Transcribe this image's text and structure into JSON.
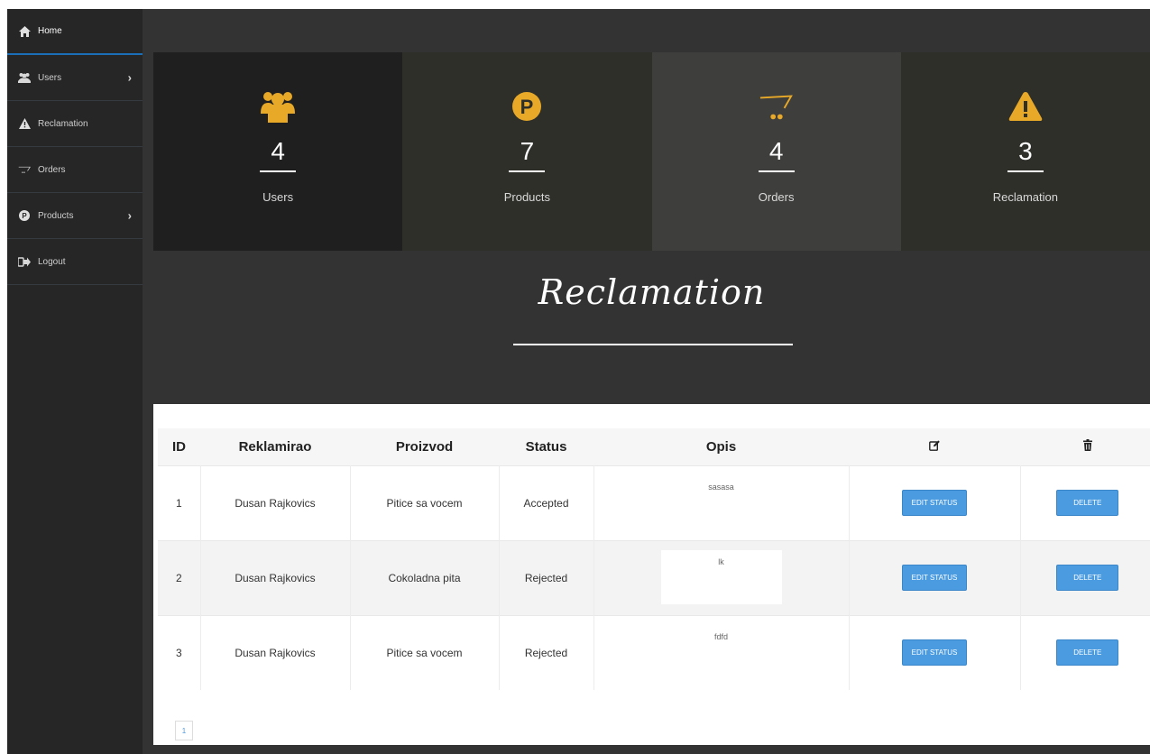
{
  "sidebar": {
    "items": [
      {
        "label": "Home",
        "icon": "home-icon",
        "active": true
      },
      {
        "label": "Users",
        "icon": "users-icon",
        "has_chevron": true
      },
      {
        "label": "Reclamation",
        "icon": "warning-icon"
      },
      {
        "label": "Orders",
        "icon": "cart-icon"
      },
      {
        "label": "Products",
        "icon": "product-p-icon",
        "has_chevron": true
      },
      {
        "label": "Logout",
        "icon": "logout-icon"
      }
    ]
  },
  "stats": [
    {
      "count": "4",
      "label": "Users",
      "icon": "users-icon"
    },
    {
      "count": "7",
      "label": "Products",
      "icon": "product-p-icon"
    },
    {
      "count": "4",
      "label": "Orders",
      "icon": "cart-icon"
    },
    {
      "count": "3",
      "label": "Reclamation",
      "icon": "warning-icon"
    }
  ],
  "page_title": "Reclamation",
  "table": {
    "headers": [
      "ID",
      "Reklamirao",
      "Proizvod",
      "Status",
      "Opis"
    ],
    "edit_header_icon": "edit-icon",
    "delete_header_icon": "trash-icon",
    "rows": [
      {
        "id": "1",
        "reklamirao": "Dusan Rajkovics",
        "proizvod": "Pitice sa vocem",
        "status": "Accepted",
        "opis": "sasasa"
      },
      {
        "id": "2",
        "reklamirao": "Dusan Rajkovics",
        "proizvod": "Cokoladna pita",
        "status": "Rejected",
        "opis": "lk"
      },
      {
        "id": "3",
        "reklamirao": "Dusan Rajkovics",
        "proizvod": "Pitice sa vocem",
        "status": "Rejected",
        "opis": "fdfd"
      }
    ],
    "edit_button_label": "EDIT STATUS",
    "delete_button_label": "DELETE"
  },
  "pagination": {
    "current_page": "1"
  },
  "colors": {
    "accent_gold": "#e8a928",
    "button_blue": "#4a9be0",
    "sidebar_bg": "#262626",
    "content_bg": "#333333"
  }
}
